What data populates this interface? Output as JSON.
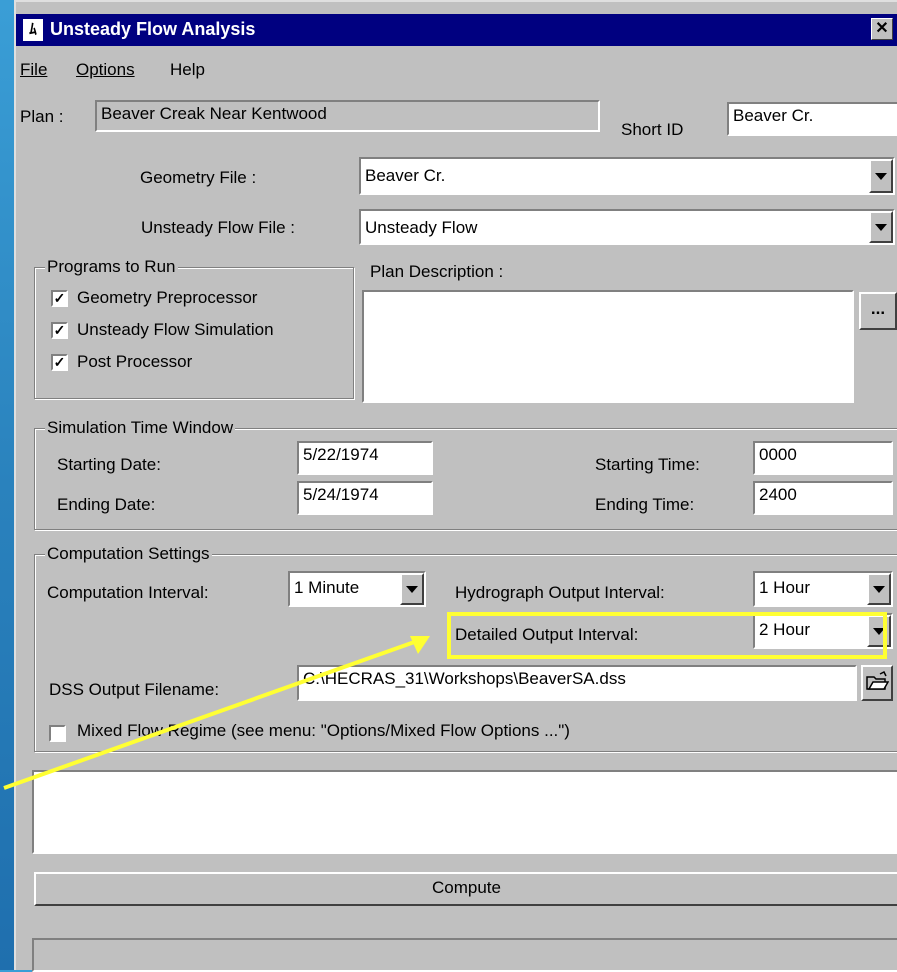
{
  "window": {
    "title": "Unsteady Flow Analysis",
    "close_glyph": "✕",
    "app_icon_glyph": "ﾑ"
  },
  "menu": {
    "file": "File",
    "options": "Options",
    "help": "Help"
  },
  "plan": {
    "label": "Plan :",
    "value": "Beaver Creak Near Kentwood",
    "short_id_label": "Short ID",
    "short_id_value": "Beaver Cr."
  },
  "geometry": {
    "label": "Geometry File :",
    "value": "Beaver Cr."
  },
  "unsteady": {
    "label": "Unsteady Flow File :",
    "value": "Unsteady Flow"
  },
  "programs": {
    "legend": "Programs to Run",
    "items": [
      {
        "label": "Geometry Preprocessor",
        "checked": true
      },
      {
        "label": "Unsteady Flow Simulation",
        "checked": true
      },
      {
        "label": "Post Processor",
        "checked": true
      }
    ],
    "check_glyph": "✓"
  },
  "plan_description": {
    "label": "Plan Description :",
    "button": "..."
  },
  "time_window": {
    "legend": "Simulation Time Window",
    "start_date_label": "Starting Date:",
    "start_date": "5/22/1974",
    "end_date_label": "Ending Date:",
    "end_date": "5/24/1974",
    "start_time_label": "Starting Time:",
    "start_time": "0000",
    "end_time_label": "Ending Time:",
    "end_time": "2400"
  },
  "computation": {
    "legend": "Computation Settings",
    "interval_label": "Computation Interval:",
    "interval_value": "1 Minute",
    "hydro_label": "Hydrograph Output Interval:",
    "hydro_value": "1 Hour",
    "detailed_label": "Detailed Output Interval:",
    "detailed_value": "2 Hour",
    "dss_label": "DSS Output Filename:",
    "dss_value": "C:\\HECRAS_31\\Workshops\\BeaverSA.dss",
    "mixed_label": "Mixed Flow Regime (see menu: \"Options/Mixed Flow Options ...\")",
    "mixed_checked": false
  },
  "compute_button": "Compute",
  "colors": {
    "highlight": "#ffff33",
    "titlebar": "#000080",
    "background": "#2a86be"
  },
  "icons": {
    "folder": "folder-open-icon",
    "dropdown": "chevron-down-icon"
  }
}
